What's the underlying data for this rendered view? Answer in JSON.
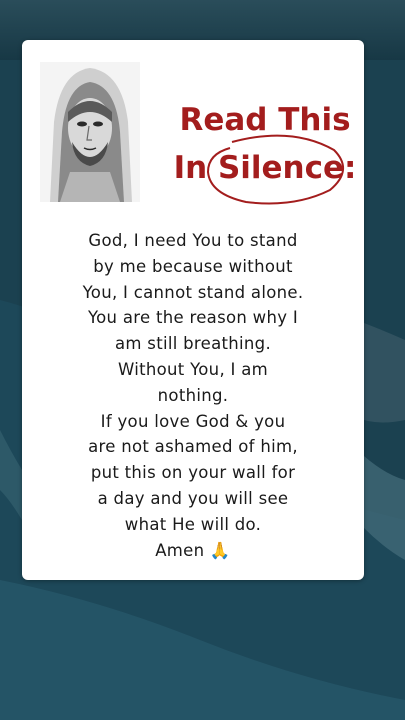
{
  "title": {
    "line1": "Read This",
    "line2": "In Silence:"
  },
  "message": {
    "lines": [
      "God, I need You to stand",
      "by me because without",
      "You, I cannot stand alone.",
      "You are the reason why I",
      "am still breathing.",
      "Without You, I am",
      "nothing.",
      "If you love God & you",
      "are not ashamed of him,",
      "put this on your wall for",
      "a day and you will see",
      "what He will do.",
      "Amen 🙏"
    ]
  },
  "colors": {
    "title": "#a31d1d",
    "card": "#ffffff",
    "background": "#1d3f4d"
  },
  "icons": [
    "praying-hands-icon",
    "portrait-image"
  ]
}
